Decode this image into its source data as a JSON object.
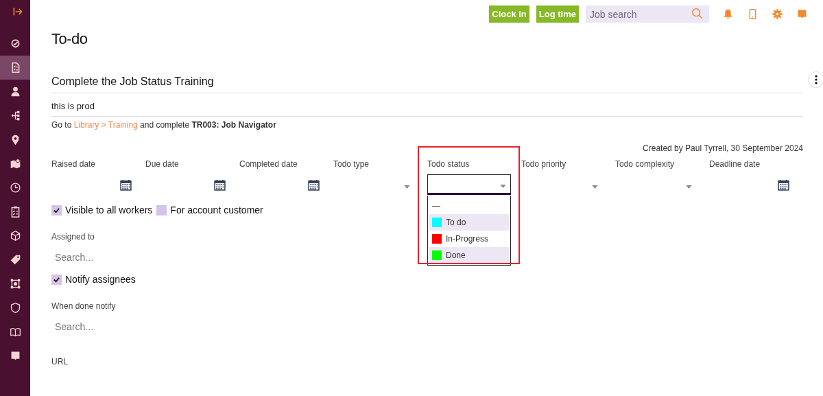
{
  "sidebar": {
    "items": [
      {
        "selected": false
      },
      {
        "selected": true
      },
      {
        "selected": false
      },
      {
        "selected": false
      },
      {
        "selected": false
      },
      {
        "selected": false
      },
      {
        "selected": false
      },
      {
        "selected": false
      },
      {
        "selected": false
      },
      {
        "selected": false
      },
      {
        "selected": false
      },
      {
        "selected": false
      },
      {
        "selected": false
      },
      {
        "selected": false
      }
    ]
  },
  "header": {
    "buttons": [
      "Clock in",
      "Log time"
    ],
    "search": {
      "placeholder": "Job search"
    }
  },
  "page_title": "To-do",
  "todo": {
    "title": "Complete the Job Status Training",
    "subtitle": "this is prod",
    "instruction": {
      "before": "Go to ",
      "link": "Library > Training",
      "after": " and complete **TR003: Job Navigator**"
    },
    "created": "Created by Paul Tyrrell, 30 September 2024",
    "fields": [
      {
        "label": "Raised date",
        "kind": "date"
      },
      {
        "label": "Due date",
        "kind": "date"
      },
      {
        "label": "Completed date",
        "kind": "date"
      },
      {
        "label": "Todo type",
        "kind": "select"
      },
      {
        "label": "Todo status",
        "kind": "select",
        "expanded": true,
        "options": [
          {
            "label": "—",
            "shaded": false
          },
          {
            "label": "To do",
            "color": "#00ffff",
            "shaded": true
          },
          {
            "label": "In-Progress",
            "color": "#ff0000",
            "shaded": false
          },
          {
            "label": "Done",
            "color": "#00ff00",
            "shaded": true
          }
        ]
      },
      {
        "label": "Todo priority",
        "kind": "select"
      },
      {
        "label": "Todo complexity",
        "kind": "select"
      },
      {
        "label": "Deadline date",
        "kind": "date"
      }
    ],
    "checkboxes": [
      {
        "label": "Visible to all workers",
        "checked": true
      },
      {
        "label": "For account customer",
        "checked": false
      }
    ],
    "assigned": {
      "label": "Assigned to",
      "placeholder": "Search..."
    },
    "notify": {
      "label": "Notify assignees",
      "checked": true
    },
    "done_notify": {
      "label": "When done notify",
      "placeholder": "Search..."
    },
    "url": {
      "label": "URL"
    }
  }
}
